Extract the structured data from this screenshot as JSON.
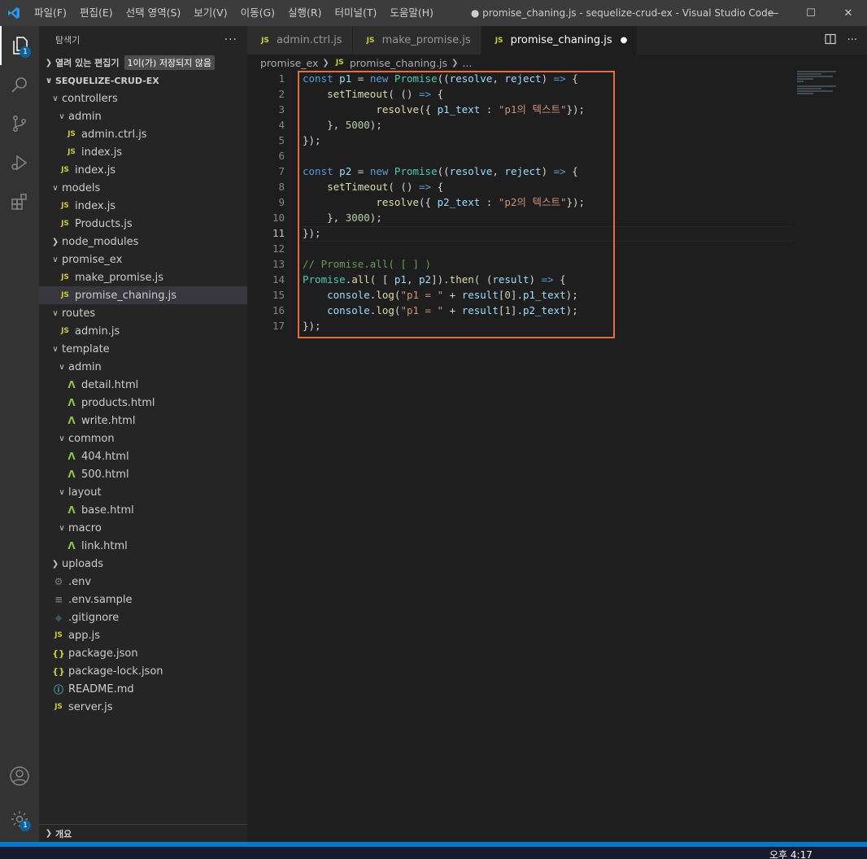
{
  "menu": [
    "파일(F)",
    "편집(E)",
    "선택 영역(S)",
    "보기(V)",
    "이동(G)",
    "실행(R)",
    "터미널(T)",
    "도움말(H)"
  ],
  "window_title": "● promise_chaning.js - sequelize-crud-ex - Visual Studio Code",
  "window_controls": {
    "minimize": "—",
    "maximize": "☐",
    "close": "✕"
  },
  "activity": {
    "explorer_badge": "1",
    "settings_badge": "1"
  },
  "sidebar": {
    "title": "탐색기",
    "more": "···",
    "open_editors": "열려 있는 편집기",
    "unsaved_badge": "1이(가) 저장되지 않음",
    "project": "SEQUELIZE-CRUD-EX",
    "tree": [
      {
        "label": "controllers",
        "depth": 1,
        "kind": "folder-open"
      },
      {
        "label": "admin",
        "depth": 2,
        "kind": "folder-open"
      },
      {
        "label": "admin.ctrl.js",
        "depth": 3,
        "kind": "js"
      },
      {
        "label": "index.js",
        "depth": 3,
        "kind": "js"
      },
      {
        "label": "index.js",
        "depth": 2,
        "kind": "js"
      },
      {
        "label": "models",
        "depth": 1,
        "kind": "folder-open"
      },
      {
        "label": "index.js",
        "depth": 2,
        "kind": "js"
      },
      {
        "label": "Products.js",
        "depth": 2,
        "kind": "js"
      },
      {
        "label": "node_modules",
        "depth": 1,
        "kind": "folder-closed"
      },
      {
        "label": "promise_ex",
        "depth": 1,
        "kind": "folder-open"
      },
      {
        "label": "make_promise.js",
        "depth": 2,
        "kind": "js"
      },
      {
        "label": "promise_chaning.js",
        "depth": 2,
        "kind": "js",
        "selected": true
      },
      {
        "label": "routes",
        "depth": 1,
        "kind": "folder-open"
      },
      {
        "label": "admin.js",
        "depth": 2,
        "kind": "js"
      },
      {
        "label": "template",
        "depth": 1,
        "kind": "folder-open"
      },
      {
        "label": "admin",
        "depth": 2,
        "kind": "folder-open"
      },
      {
        "label": "detail.html",
        "depth": 3,
        "kind": "html"
      },
      {
        "label": "products.html",
        "depth": 3,
        "kind": "html"
      },
      {
        "label": "write.html",
        "depth": 3,
        "kind": "html"
      },
      {
        "label": "common",
        "depth": 2,
        "kind": "folder-open"
      },
      {
        "label": "404.html",
        "depth": 3,
        "kind": "html"
      },
      {
        "label": "500.html",
        "depth": 3,
        "kind": "html"
      },
      {
        "label": "layout",
        "depth": 2,
        "kind": "folder-open"
      },
      {
        "label": "base.html",
        "depth": 3,
        "kind": "html"
      },
      {
        "label": "macro",
        "depth": 2,
        "kind": "folder-open"
      },
      {
        "label": "link.html",
        "depth": 3,
        "kind": "html"
      },
      {
        "label": "uploads",
        "depth": 1,
        "kind": "folder-closed"
      },
      {
        "label": ".env",
        "depth": 1,
        "kind": "cfg"
      },
      {
        "label": ".env.sample",
        "depth": 1,
        "kind": "lines"
      },
      {
        "label": ".gitignore",
        "depth": 1,
        "kind": "git"
      },
      {
        "label": "app.js",
        "depth": 1,
        "kind": "js"
      },
      {
        "label": "package.json",
        "depth": 1,
        "kind": "json"
      },
      {
        "label": "package-lock.json",
        "depth": 1,
        "kind": "json"
      },
      {
        "label": "README.md",
        "depth": 1,
        "kind": "info"
      },
      {
        "label": "server.js",
        "depth": 1,
        "kind": "js"
      }
    ],
    "outline": "개요"
  },
  "tabs": [
    {
      "label": "admin.ctrl.js",
      "active": false
    },
    {
      "label": "make_promise.js",
      "active": false
    },
    {
      "label": "promise_chaning.js",
      "active": true,
      "dirty": "●"
    }
  ],
  "breadcrumb": [
    "promise_ex",
    "promise_chaning.js",
    "..."
  ],
  "editor": {
    "line_numbers": [
      "1",
      "2",
      "3",
      "4",
      "5",
      "6",
      "7",
      "8",
      "9",
      "10",
      "11",
      "12",
      "13",
      "14",
      "15",
      "16",
      "17"
    ],
    "lines": [
      [
        [
          "kw",
          "const"
        ],
        [
          "pn",
          " "
        ],
        [
          "var",
          "p1"
        ],
        [
          "pn",
          " = "
        ],
        [
          "kw",
          "new"
        ],
        [
          "pn",
          " "
        ],
        [
          "cls",
          "Promise"
        ],
        [
          "pn",
          "(("
        ],
        [
          "var",
          "resolve"
        ],
        [
          "pn",
          ", "
        ],
        [
          "var",
          "reject"
        ],
        [
          "pn",
          ") "
        ],
        [
          "kw",
          "=>"
        ],
        [
          "pn",
          " {"
        ]
      ],
      [
        [
          "pn",
          "    "
        ],
        [
          "fn",
          "setTimeout"
        ],
        [
          "pn",
          "( () "
        ],
        [
          "kw",
          "=>"
        ],
        [
          "pn",
          " {"
        ]
      ],
      [
        [
          "pn",
          "            "
        ],
        [
          "fn",
          "resolve"
        ],
        [
          "pn",
          "({ "
        ],
        [
          "var",
          "p1_text"
        ],
        [
          "pn",
          " : "
        ],
        [
          "str",
          "\"p1의 텍스트\""
        ],
        [
          "pn",
          "});"
        ]
      ],
      [
        [
          "pn",
          "    }, "
        ],
        [
          "num",
          "5000"
        ],
        [
          "pn",
          ");"
        ]
      ],
      [
        [
          "pn",
          "});"
        ]
      ],
      [],
      [
        [
          "kw",
          "const"
        ],
        [
          "pn",
          " "
        ],
        [
          "var",
          "p2"
        ],
        [
          "pn",
          " = "
        ],
        [
          "kw",
          "new"
        ],
        [
          "pn",
          " "
        ],
        [
          "cls",
          "Promise"
        ],
        [
          "pn",
          "(("
        ],
        [
          "var",
          "resolve"
        ],
        [
          "pn",
          ", "
        ],
        [
          "var",
          "reject"
        ],
        [
          "pn",
          ") "
        ],
        [
          "kw",
          "=>"
        ],
        [
          "pn",
          " {"
        ]
      ],
      [
        [
          "pn",
          "    "
        ],
        [
          "fn",
          "setTimeout"
        ],
        [
          "pn",
          "( () "
        ],
        [
          "kw",
          "=>"
        ],
        [
          "pn",
          " {"
        ]
      ],
      [
        [
          "pn",
          "            "
        ],
        [
          "fn",
          "resolve"
        ],
        [
          "pn",
          "({ "
        ],
        [
          "var",
          "p2_text"
        ],
        [
          "pn",
          " : "
        ],
        [
          "str",
          "\"p2의 텍스트\""
        ],
        [
          "pn",
          "});"
        ]
      ],
      [
        [
          "pn",
          "    }, "
        ],
        [
          "num",
          "3000"
        ],
        [
          "pn",
          ");"
        ]
      ],
      [
        [
          "pn",
          "});"
        ]
      ],
      [],
      [
        [
          "cm",
          "// Promise.all( [ ] )"
        ]
      ],
      [
        [
          "cls",
          "Promise"
        ],
        [
          "pn",
          "."
        ],
        [
          "fn",
          "all"
        ],
        [
          "pn",
          "( [ "
        ],
        [
          "var",
          "p1"
        ],
        [
          "pn",
          ", "
        ],
        [
          "var",
          "p2"
        ],
        [
          "pn",
          "])."
        ],
        [
          "fn",
          "then"
        ],
        [
          "pn",
          "( ("
        ],
        [
          "var",
          "result"
        ],
        [
          "pn",
          ") "
        ],
        [
          "kw",
          "=>"
        ],
        [
          "pn",
          " {"
        ]
      ],
      [
        [
          "pn",
          "    "
        ],
        [
          "var",
          "console"
        ],
        [
          "pn",
          "."
        ],
        [
          "fn",
          "log"
        ],
        [
          "pn",
          "("
        ],
        [
          "str",
          "\"p1 = \""
        ],
        [
          "pn",
          " + "
        ],
        [
          "var",
          "result"
        ],
        [
          "pn",
          "["
        ],
        [
          "num",
          "0"
        ],
        [
          "pn",
          "]."
        ],
        [
          "var",
          "p1_text"
        ],
        [
          "pn",
          ");"
        ]
      ],
      [
        [
          "pn",
          "    "
        ],
        [
          "var",
          "console"
        ],
        [
          "pn",
          "."
        ],
        [
          "fn",
          "log"
        ],
        [
          "pn",
          "("
        ],
        [
          "str",
          "\"p1 = \""
        ],
        [
          "pn",
          " + "
        ],
        [
          "var",
          "result"
        ],
        [
          "pn",
          "["
        ],
        [
          "num",
          "1"
        ],
        [
          "pn",
          "]."
        ],
        [
          "var",
          "p2_text"
        ],
        [
          "pn",
          ");"
        ]
      ],
      [
        [
          "pn",
          "});"
        ]
      ]
    ]
  },
  "taskbar": {
    "clock": "오후 4:17"
  },
  "colors": {
    "accent": "#007acc",
    "highlight_box": "#e36f3f"
  }
}
